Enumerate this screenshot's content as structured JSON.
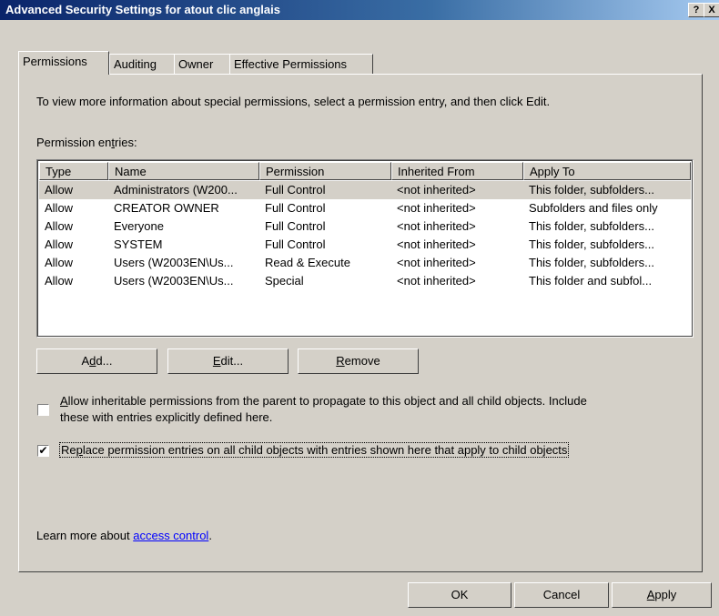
{
  "window": {
    "title": "Advanced Security Settings for atout clic anglais",
    "help_label": "?",
    "close_label": "X"
  },
  "tabs": [
    {
      "label": "Permissions"
    },
    {
      "label": "Auditing"
    },
    {
      "label": "Owner"
    },
    {
      "label": "Effective Permissions"
    }
  ],
  "intro_text": "To view more information about special permissions, select a permission entry, and then click Edit.",
  "entries_label": {
    "pre": "Permission en",
    "accel": "t",
    "post": "ries:"
  },
  "table": {
    "columns": [
      "Type",
      "Name",
      "Permission",
      "Inherited From",
      "Apply To"
    ],
    "rows": [
      [
        "Allow",
        "Administrators (W200...",
        "Full Control",
        "<not inherited>",
        "This folder, subfolders..."
      ],
      [
        "Allow",
        "CREATOR OWNER",
        "Full Control",
        "<not inherited>",
        "Subfolders and files only"
      ],
      [
        "Allow",
        "Everyone",
        "Full Control",
        "<not inherited>",
        "This folder, subfolders..."
      ],
      [
        "Allow",
        "SYSTEM",
        "Full Control",
        "<not inherited>",
        "This folder, subfolders..."
      ],
      [
        "Allow",
        "Users (W2003EN\\Us...",
        "Read & Execute",
        "<not inherited>",
        "This folder, subfolders..."
      ],
      [
        "Allow",
        "Users (W2003EN\\Us...",
        "Special",
        "<not inherited>",
        "This folder and subfol..."
      ]
    ],
    "selected_row": 0
  },
  "buttons": {
    "add": {
      "pre": "A",
      "accel": "d",
      "post": "d..."
    },
    "edit": {
      "pre": "",
      "accel": "E",
      "post": "dit..."
    },
    "remove": {
      "pre": "",
      "accel": "R",
      "post": "emove"
    }
  },
  "options": {
    "inherit": {
      "checked": false,
      "accel": "A",
      "line1_rest": "llow inheritable permissions from the parent to propagate to this object and all child objects. Include",
      "line2": "these with entries explicitly defined here."
    },
    "replace": {
      "checked": true,
      "pre": "Re",
      "accel": "p",
      "post": "lace permission entries on all child objects with entries shown here that apply to child objects"
    }
  },
  "learn_more": {
    "text": "Learn more about ",
    "link": "access control",
    "suffix": "."
  },
  "footer": {
    "ok": "OK",
    "cancel": "Cancel",
    "apply": {
      "accel": "A",
      "post": "pply"
    }
  }
}
